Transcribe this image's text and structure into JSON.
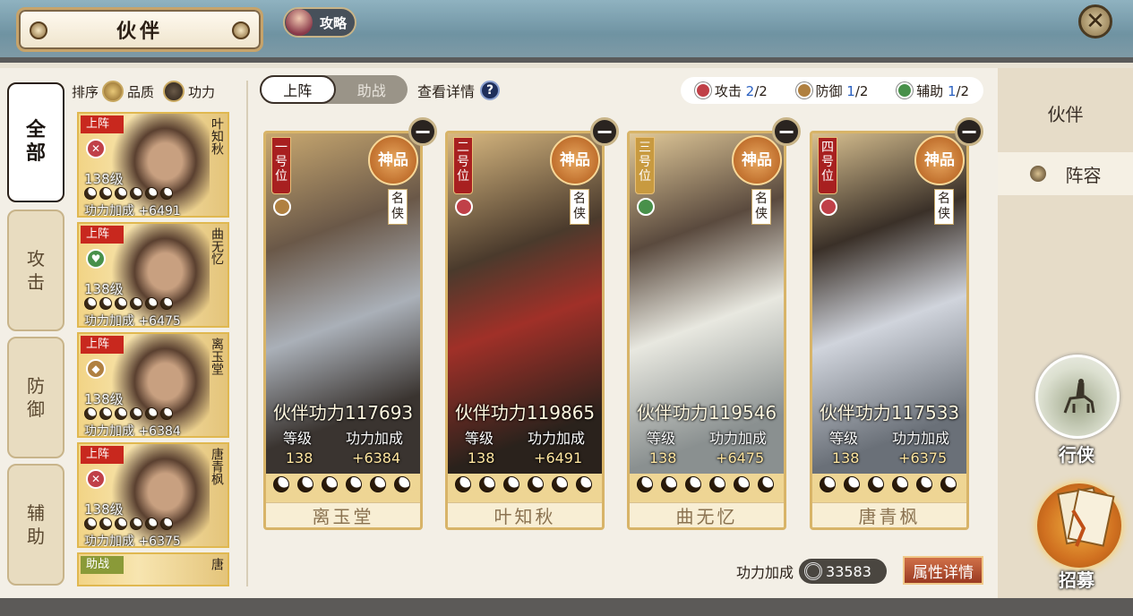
{
  "header": {
    "title": "伙伴",
    "guide_label": "攻略",
    "close_symbol": "✕"
  },
  "right_tabs": [
    {
      "label": "伙伴",
      "active": false
    },
    {
      "label": "阵容",
      "active": true
    }
  ],
  "side_actions": {
    "wander_label": "行侠",
    "recruit_label": "招募"
  },
  "filter_tabs": [
    {
      "label": "全部",
      "active": true
    },
    {
      "label": "攻击",
      "active": false
    },
    {
      "label": "防御",
      "active": false
    },
    {
      "label": "辅助",
      "active": false
    }
  ],
  "sort": {
    "label": "排序",
    "option_quality": "品质",
    "option_power": "功力",
    "selected": "品质"
  },
  "partner_list": [
    {
      "status": "上阵",
      "name": "叶知秋",
      "level": "138级",
      "power_text": "功力加成 +6491",
      "role": "attack"
    },
    {
      "status": "上阵",
      "name": "曲无忆",
      "level": "138级",
      "power_text": "功力加成 +6475",
      "role": "support"
    },
    {
      "status": "上阵",
      "name": "离玉堂",
      "level": "138级",
      "power_text": "功力加成 +6384",
      "role": "defense"
    },
    {
      "status": "上阵",
      "name": "唐青枫",
      "level": "138级",
      "power_text": "功力加成 +6375",
      "role": "attack"
    },
    {
      "status": "助战",
      "name": "唐",
      "level": "",
      "power_text": "",
      "role": ""
    }
  ],
  "mode_toggle": {
    "on_field": "上阵",
    "assist": "助战",
    "active": "上阵"
  },
  "view_details": "查看详情",
  "help_symbol": "?",
  "role_counts": [
    {
      "label": "攻击",
      "current": "2",
      "max": "/2",
      "color": "#c04048"
    },
    {
      "label": "防御",
      "current": "1",
      "max": "/2",
      "color": "#b08040"
    },
    {
      "label": "辅助",
      "current": "1",
      "max": "/2",
      "color": "#48904a"
    }
  ],
  "lineup": [
    {
      "slot": "一号位",
      "rank": "神品",
      "title": "名侠",
      "name": "离玉堂",
      "power_label": "伙伴功力",
      "power": "117693",
      "level_label": "等级",
      "level": "138",
      "bonus_label": "功力加成",
      "bonus": "+6384",
      "role_color": "#b08040"
    },
    {
      "slot": "二号位",
      "rank": "神品",
      "title": "名侠",
      "name": "叶知秋",
      "power_label": "伙伴功力",
      "power": "119865",
      "level_label": "等级",
      "level": "138",
      "bonus_label": "功力加成",
      "bonus": "+6491",
      "role_color": "#c04048"
    },
    {
      "slot": "三号位",
      "rank": "神品",
      "title": "名侠",
      "name": "曲无忆",
      "power_label": "伙伴功力",
      "power": "119546",
      "level_label": "等级",
      "level": "138",
      "bonus_label": "功力加成",
      "bonus": "+6475",
      "role_color": "#48904a"
    },
    {
      "slot": "四号位",
      "rank": "神品",
      "title": "名侠",
      "name": "唐青枫",
      "power_label": "伙伴功力",
      "power": "117533",
      "level_label": "等级",
      "level": "138",
      "bonus_label": "功力加成",
      "bonus": "+6375",
      "role_color": "#c04048"
    }
  ],
  "total_bonus": {
    "label": "功力加成",
    "value": "33583"
  },
  "attr_details_button": "属性详情",
  "remove_symbol": "−"
}
